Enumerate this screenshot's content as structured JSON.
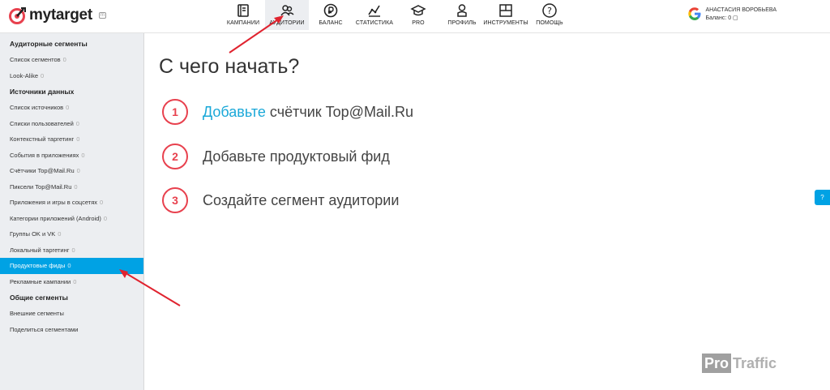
{
  "header": {
    "logo_text": "mytarget",
    "logo_badge": "m",
    "nav": [
      {
        "label": "КАМПАНИИ",
        "icon": "campaigns-icon",
        "active": false
      },
      {
        "label": "АУДИТОРИИ",
        "icon": "audiences-icon",
        "active": true
      },
      {
        "label": "БАЛАНС",
        "icon": "balance-icon",
        "active": false
      },
      {
        "label": "СТАТИСТИКА",
        "icon": "statistics-icon",
        "active": false
      },
      {
        "label": "PRO",
        "icon": "pro-icon",
        "active": false
      },
      {
        "label": "ПРОФИЛЬ",
        "icon": "profile-icon",
        "active": false
      },
      {
        "label": "ИНСТРУМЕНТЫ",
        "icon": "tools-icon",
        "active": false
      },
      {
        "label": "ПОМОЩЬ",
        "icon": "help-icon",
        "active": false
      }
    ],
    "user": {
      "name": "АНАСТАСИЯ ВОРОБЬЕВА",
      "balance": "Баланс: 0 ▢"
    }
  },
  "sidebar": {
    "sections": [
      {
        "title": "Аудиторные сегменты",
        "items": [
          {
            "label": "Список сегментов",
            "count": "0"
          },
          {
            "label": "Look-Alike",
            "count": "0"
          }
        ]
      },
      {
        "title": "Источники данных",
        "items": [
          {
            "label": "Список источников",
            "count": "0"
          },
          {
            "label": "Списки пользователей",
            "count": "0"
          },
          {
            "label": "Контекстный таргетинг",
            "count": "0"
          },
          {
            "label": "События в приложениях",
            "count": "0"
          },
          {
            "label": "Счётчики Top@Mail.Ru",
            "count": "0"
          },
          {
            "label": "Пиксели Top@Mail.Ru",
            "count": "0"
          },
          {
            "label": "Приложения и игры в соцсетях",
            "count": "0"
          },
          {
            "label": "Категории приложений (Android)",
            "count": "0"
          },
          {
            "label": "Группы OK и VK",
            "count": "0"
          },
          {
            "label": "Локальный таргетинг",
            "count": "0"
          },
          {
            "label": "Продуктовые фиды",
            "count": "0"
          },
          {
            "label": "Рекламные кампании",
            "count": "0"
          }
        ]
      },
      {
        "title": "Общие сегменты",
        "items": [
          {
            "label": "Внешние сегменты",
            "count": ""
          },
          {
            "label": "Поделиться сегментами",
            "count": ""
          }
        ]
      }
    ],
    "active_item": "Продуктовые фиды"
  },
  "main": {
    "title": "С чего начать?",
    "steps": [
      {
        "number": "1",
        "link": "Добавьте",
        "text": " счётчик Top@Mail.Ru"
      },
      {
        "number": "2",
        "link": "",
        "text": "Добавьте продуктовый фид"
      },
      {
        "number": "3",
        "link": "",
        "text": "Создайте сегмент аудитории"
      }
    ]
  },
  "help_tab": "?",
  "watermark": {
    "box": "Pro",
    "text": "Traffic"
  },
  "colors": {
    "accent": "#00a2e4",
    "step_red": "#e8414e",
    "link": "#1aa8d8",
    "arrow": "#e0232f"
  }
}
